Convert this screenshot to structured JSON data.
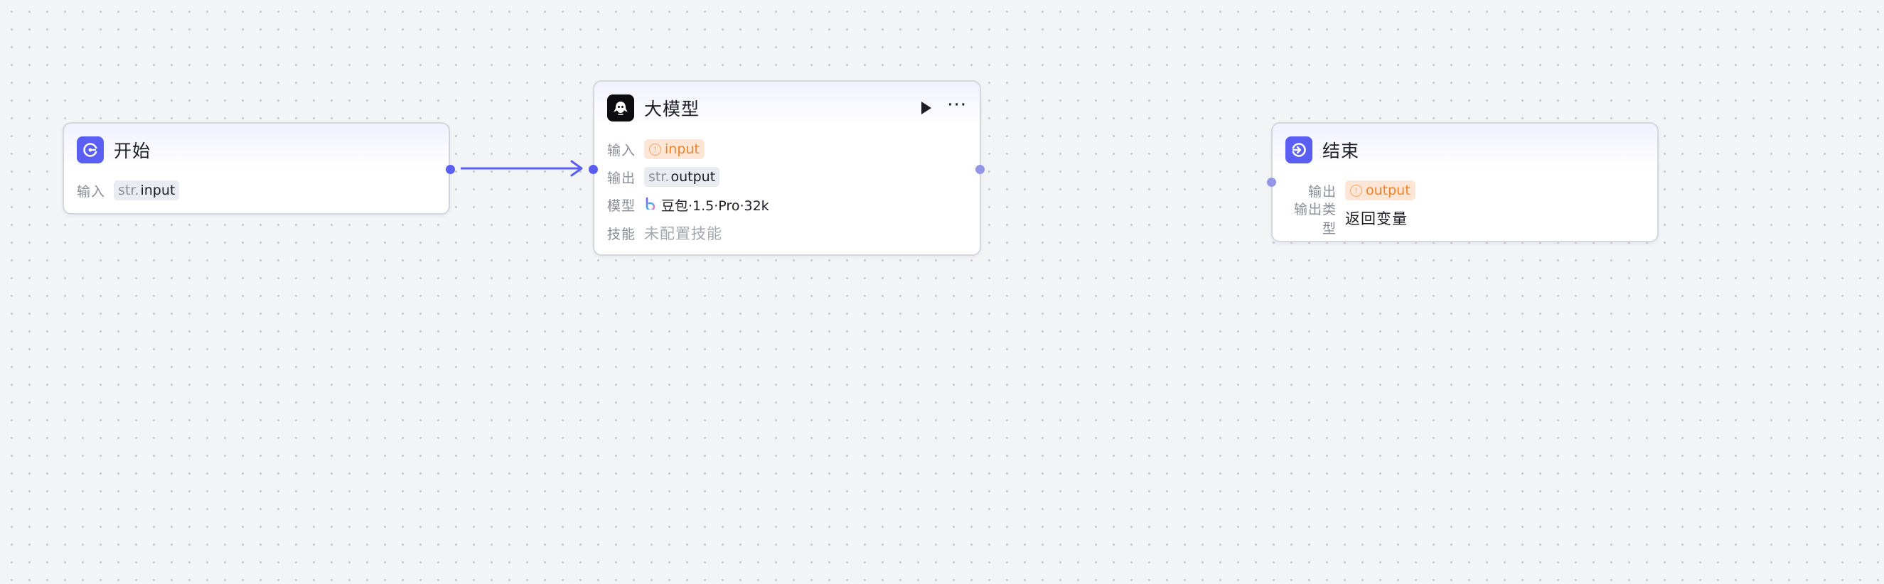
{
  "nodes": {
    "start": {
      "title": "开始",
      "input_label": "输入",
      "input_type_prefix": "str.",
      "input_var": "input"
    },
    "llm": {
      "title": "大模型",
      "input_label": "输入",
      "input_ref": "input",
      "output_label": "输出",
      "output_type_prefix": "str.",
      "output_var": "output",
      "model_label": "模型",
      "model_value": "豆包·1.5·Pro·32k",
      "skills_label": "技能",
      "skills_value": "未配置技能",
      "more_label": "···"
    },
    "end": {
      "title": "结束",
      "output_label": "输出",
      "output_ref": "output",
      "output_type_label": "输出类型",
      "output_type_value": "返回变量"
    }
  },
  "colors": {
    "accent": "#5b5ef2",
    "ref_text": "#f0822b",
    "ref_bg": "#fde6d6",
    "canvas_bg": "#f3f4f6"
  },
  "icons": {
    "start": "start-icon",
    "llm": "llm-icon",
    "end": "end-icon",
    "run": "play-icon",
    "more": "more-icon",
    "model": "doubao-icon",
    "ref": "reference-icon"
  }
}
